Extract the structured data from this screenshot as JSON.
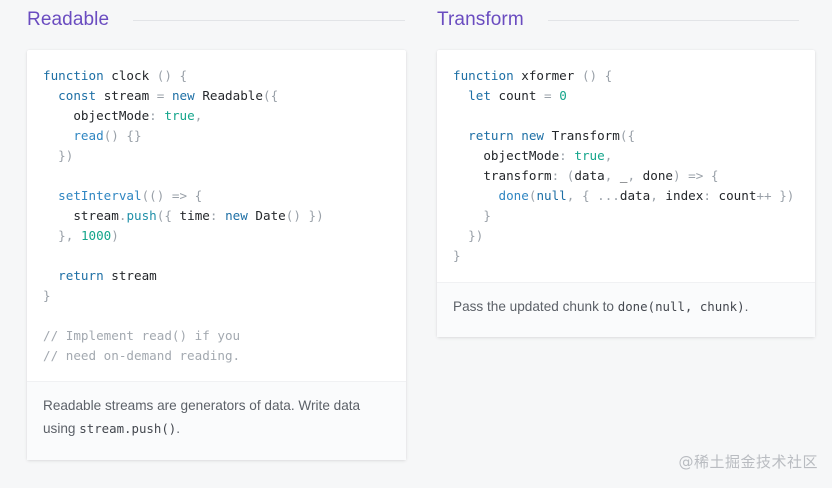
{
  "sections": {
    "readable": {
      "title": "Readable",
      "footer_text_1": "Readable streams are generators of data. Write data using ",
      "footer_code": "stream.push()",
      "footer_text_2": "."
    },
    "transform": {
      "title": "Transform",
      "footer_text_1": "Pass the updated chunk to ",
      "footer_code": "done(null, chunk)",
      "footer_text_2": "."
    }
  },
  "tokens": {
    "function": "function",
    "const": "const",
    "let": "let",
    "new": "new",
    "return": "return",
    "true": "true",
    "null": "null",
    "clock": "clock",
    "stream": "stream",
    "Readable": "Readable",
    "objectMode": "objectMode",
    "read": "read",
    "setInterval": "setInterval",
    "push": "push",
    "time": "time",
    "Date": "Date",
    "n1000": "1000",
    "comment1": "// Implement read() if you",
    "comment2": "// need on-demand reading.",
    "xformer": "xformer",
    "count": "count",
    "n0": "0",
    "Transform": "Transform",
    "transform": "transform",
    "data": "data",
    "underscore": "_",
    "done": "done",
    "index": "index",
    "spread": "...",
    "incr": "++"
  },
  "watermark": "@稀土掘金技术社区"
}
